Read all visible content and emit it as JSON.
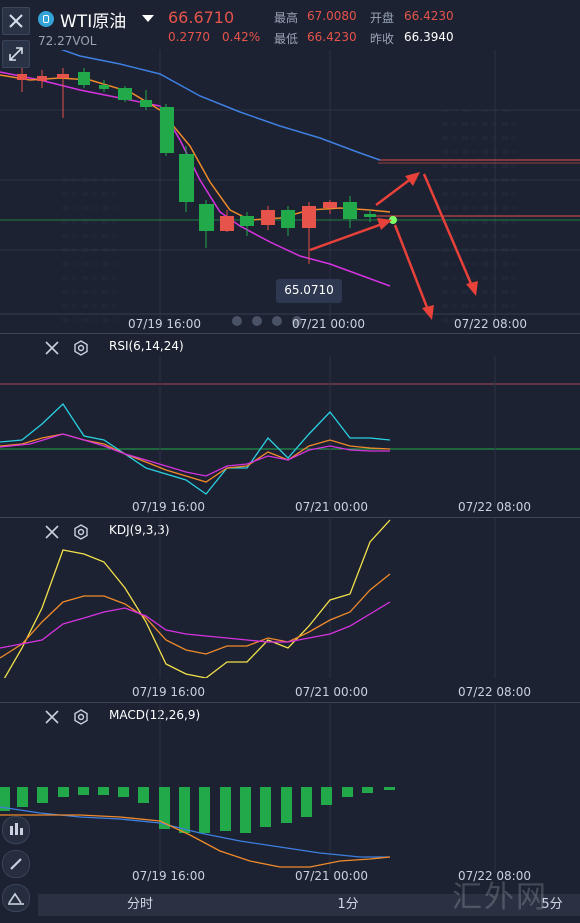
{
  "header": {
    "symbol": "WTI原油",
    "price": "66.6710",
    "change": "0.2770",
    "change_pct": "0.42%",
    "high_label": "最高",
    "high_value": "67.0080",
    "open_label": "开盘",
    "open_value": "66.4230",
    "low_label": "最低",
    "low_value": "66.4230",
    "prev_close_label": "昨收",
    "prev_close_value": "66.3940",
    "sub_text": "72.27VOL"
  },
  "main_chart": {
    "price_tag": "65.0710",
    "time_ticks": [
      "07/19 16:00",
      "07/21 00:00",
      "07/22 08:00"
    ]
  },
  "indicators": {
    "rsi": {
      "title": "RSI(6,14,24)",
      "time_ticks": [
        "07/19 16:00",
        "07/21 00:00",
        "07/22 08:00"
      ]
    },
    "kdj": {
      "title": "KDJ(9,3,3)",
      "time_ticks": [
        "07/19 16:00",
        "07/21 00:00",
        "07/22 08:00"
      ]
    },
    "macd": {
      "title": "MACD(12,26,9)",
      "time_ticks": [
        "07/19 16:00",
        "07/21 00:00",
        "07/22 08:00"
      ]
    }
  },
  "bottom_tabs": [
    "分时",
    "1分",
    "5分"
  ],
  "watermark": "汇外网",
  "colors": {
    "up": "#e5534b",
    "down": "#22a94a",
    "background": "#1c2232",
    "arrow": "#e8413a",
    "ma_orange": "#f08a2a",
    "ma_magenta": "#d633e0",
    "ma_blue": "#3f7fe0",
    "rsi_cyan": "#2ad0e0",
    "kdj_yellow": "#f2e04a"
  },
  "icons": [
    "close-icon",
    "gear-icon",
    "candle-settings-icon",
    "pencil-icon",
    "drawing-tools-icon",
    "symbol-logo-icon",
    "dropdown-icon"
  ]
}
